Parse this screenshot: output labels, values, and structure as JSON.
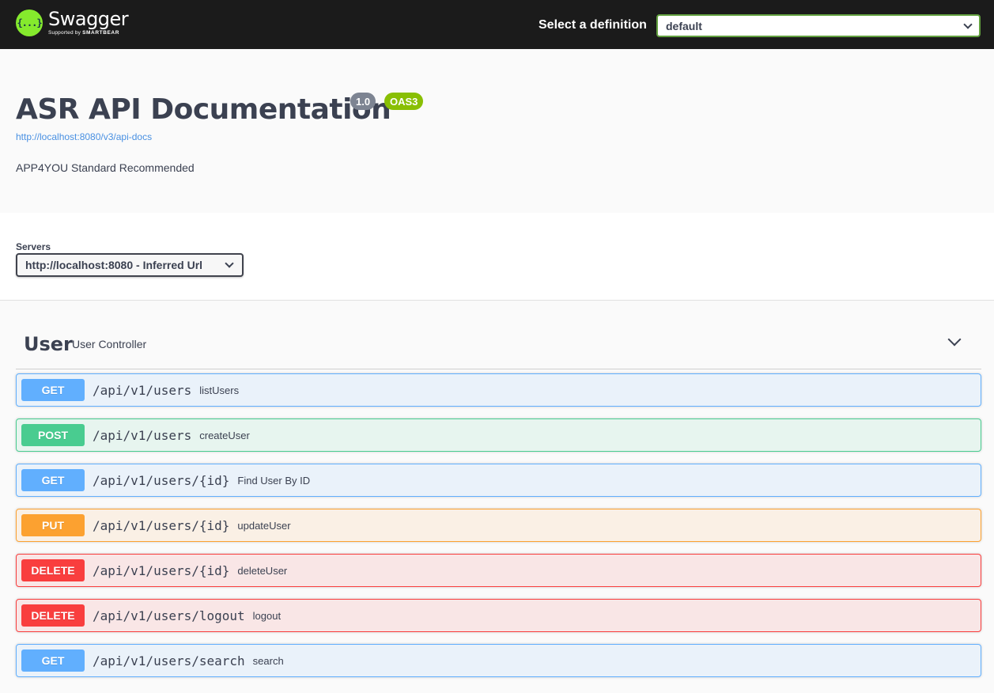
{
  "topbar": {
    "logo_name": "Swagger",
    "logo_sub_prefix": "Supported by",
    "logo_sub_brand": "SMARTBEAR",
    "logo_icon": "{...}",
    "definition_label": "Select a definition",
    "definition_value": "default"
  },
  "info": {
    "title": "ASR API Documentation",
    "version": "1.0",
    "oas": "OAS3",
    "docs_url": "http://localhost:8080/v3/api-docs",
    "description": "APP4YOU Standard Recommended"
  },
  "servers": {
    "label": "Servers",
    "selected": "http://localhost:8080 - Inferred Url"
  },
  "tag": {
    "name": "User",
    "description": "User Controller",
    "toggle_icon": "chevron-down-icon"
  },
  "operations": [
    {
      "method": "GET",
      "path": "/api/v1/users",
      "summary": "listUsers"
    },
    {
      "method": "POST",
      "path": "/api/v1/users",
      "summary": "createUser"
    },
    {
      "method": "GET",
      "path": "/api/v1/users/{id}",
      "summary": "Find User By ID"
    },
    {
      "method": "PUT",
      "path": "/api/v1/users/{id}",
      "summary": "updateUser"
    },
    {
      "method": "DELETE",
      "path": "/api/v1/users/{id}",
      "summary": "deleteUser"
    },
    {
      "method": "DELETE",
      "path": "/api/v1/users/logout",
      "summary": "logout"
    },
    {
      "method": "GET",
      "path": "/api/v1/users/search",
      "summary": "search"
    }
  ],
  "colors": {
    "get": "#61affe",
    "post": "#49cc90",
    "put": "#fca130",
    "delete": "#f93e3e",
    "brand": "#85ea2d"
  }
}
